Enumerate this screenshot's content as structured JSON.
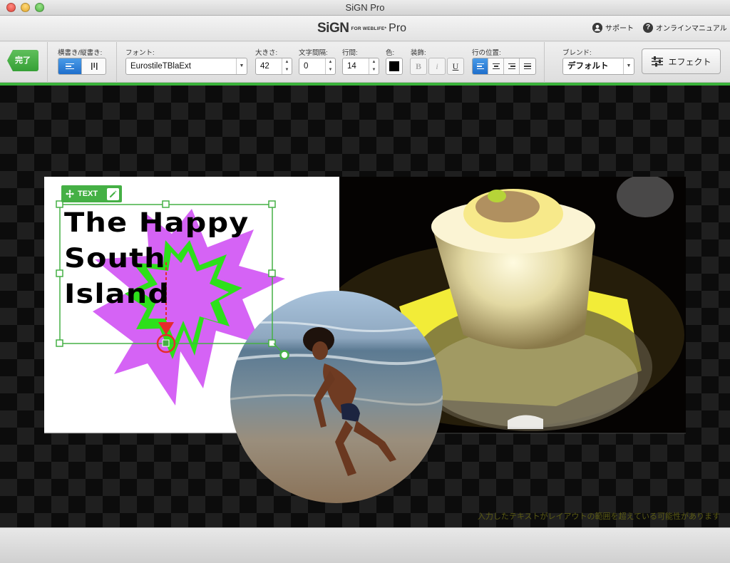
{
  "window": {
    "title": "SiGN Pro"
  },
  "header": {
    "brand_name": "SiGN",
    "brand_sub": "FOR WEBLIFE*",
    "brand_edition": "Pro",
    "support_label": "サポート",
    "manual_label": "オンラインマニュアル"
  },
  "toolbar": {
    "done_label": "完了",
    "orientation_label": "横書き/縦書き:",
    "font_label": "フォント:",
    "font_value": "EurostileTBlaExt",
    "size_label": "大きさ:",
    "size_value": "42",
    "spacing_label": "文字間隔:",
    "spacing_value": "0",
    "leading_label": "行間:",
    "leading_value": "14",
    "color_label": "色:",
    "color_value": "#000000",
    "decoration_label": "装飾:",
    "bold_label": "B",
    "italic_label": "i",
    "underline_label": "U",
    "align_label": "行の位置:",
    "blend_label": "ブレンド:",
    "blend_value": "デフォルト",
    "effect_label": "エフェクト"
  },
  "canvas": {
    "text_tag_label": "TEXT",
    "text_content": [
      "The Happy",
      "South",
      "Island"
    ],
    "warning": "入力したテキストがレイアウトの範囲を超えている可能性があります"
  },
  "colors": {
    "accent_green": "#3bb33b",
    "star_purple": "#d563f5",
    "star_green": "#2de01a",
    "selection_blue": "#1f6fcc"
  },
  "icons": [
    "support-person-icon",
    "help-question-icon",
    "horizontal-text-icon",
    "vertical-text-icon",
    "align-left-icon",
    "align-center-icon",
    "align-right-icon",
    "align-justify-icon",
    "effect-sliders-icon",
    "move-icon",
    "edit-pencil-icon"
  ]
}
